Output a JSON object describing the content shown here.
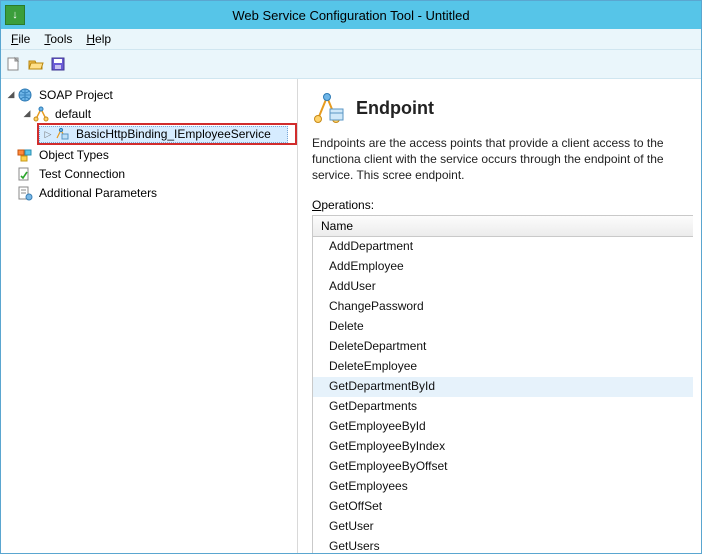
{
  "window": {
    "title": "Web Service Configuration Tool - Untitled"
  },
  "menu": {
    "file": {
      "u": "F",
      "rest": "ile"
    },
    "tools": {
      "u": "T",
      "rest": "ools"
    },
    "help": {
      "u": "H",
      "rest": "elp"
    }
  },
  "tree": {
    "root": {
      "label": "SOAP Project",
      "children": [
        {
          "label": "default",
          "children": [
            {
              "label": "BasicHttpBinding_IEmployeeService",
              "selected": true
            }
          ]
        }
      ]
    },
    "siblings": [
      {
        "label": "Object Types"
      },
      {
        "label": "Test Connection"
      },
      {
        "label": "Additional Parameters"
      }
    ]
  },
  "content": {
    "heading": "Endpoint",
    "description": "Endpoints are the access points that provide a client access to the functiona client with the service occurs through the endpoint of the service. This scree endpoint.",
    "operations_label": {
      "u": "O",
      "rest": "perations:"
    },
    "grid": {
      "header": "Name",
      "selected_index": 7,
      "rows": [
        "AddDepartment",
        "AddEmployee",
        "AddUser",
        "ChangePassword",
        "Delete",
        "DeleteDepartment",
        "DeleteEmployee",
        "GetDepartmentById",
        "GetDepartments",
        "GetEmployeeById",
        "GetEmployeeByIndex",
        "GetEmployeeByOffset",
        "GetEmployees",
        "GetOffSet",
        "GetUser",
        "GetUsers"
      ]
    }
  }
}
